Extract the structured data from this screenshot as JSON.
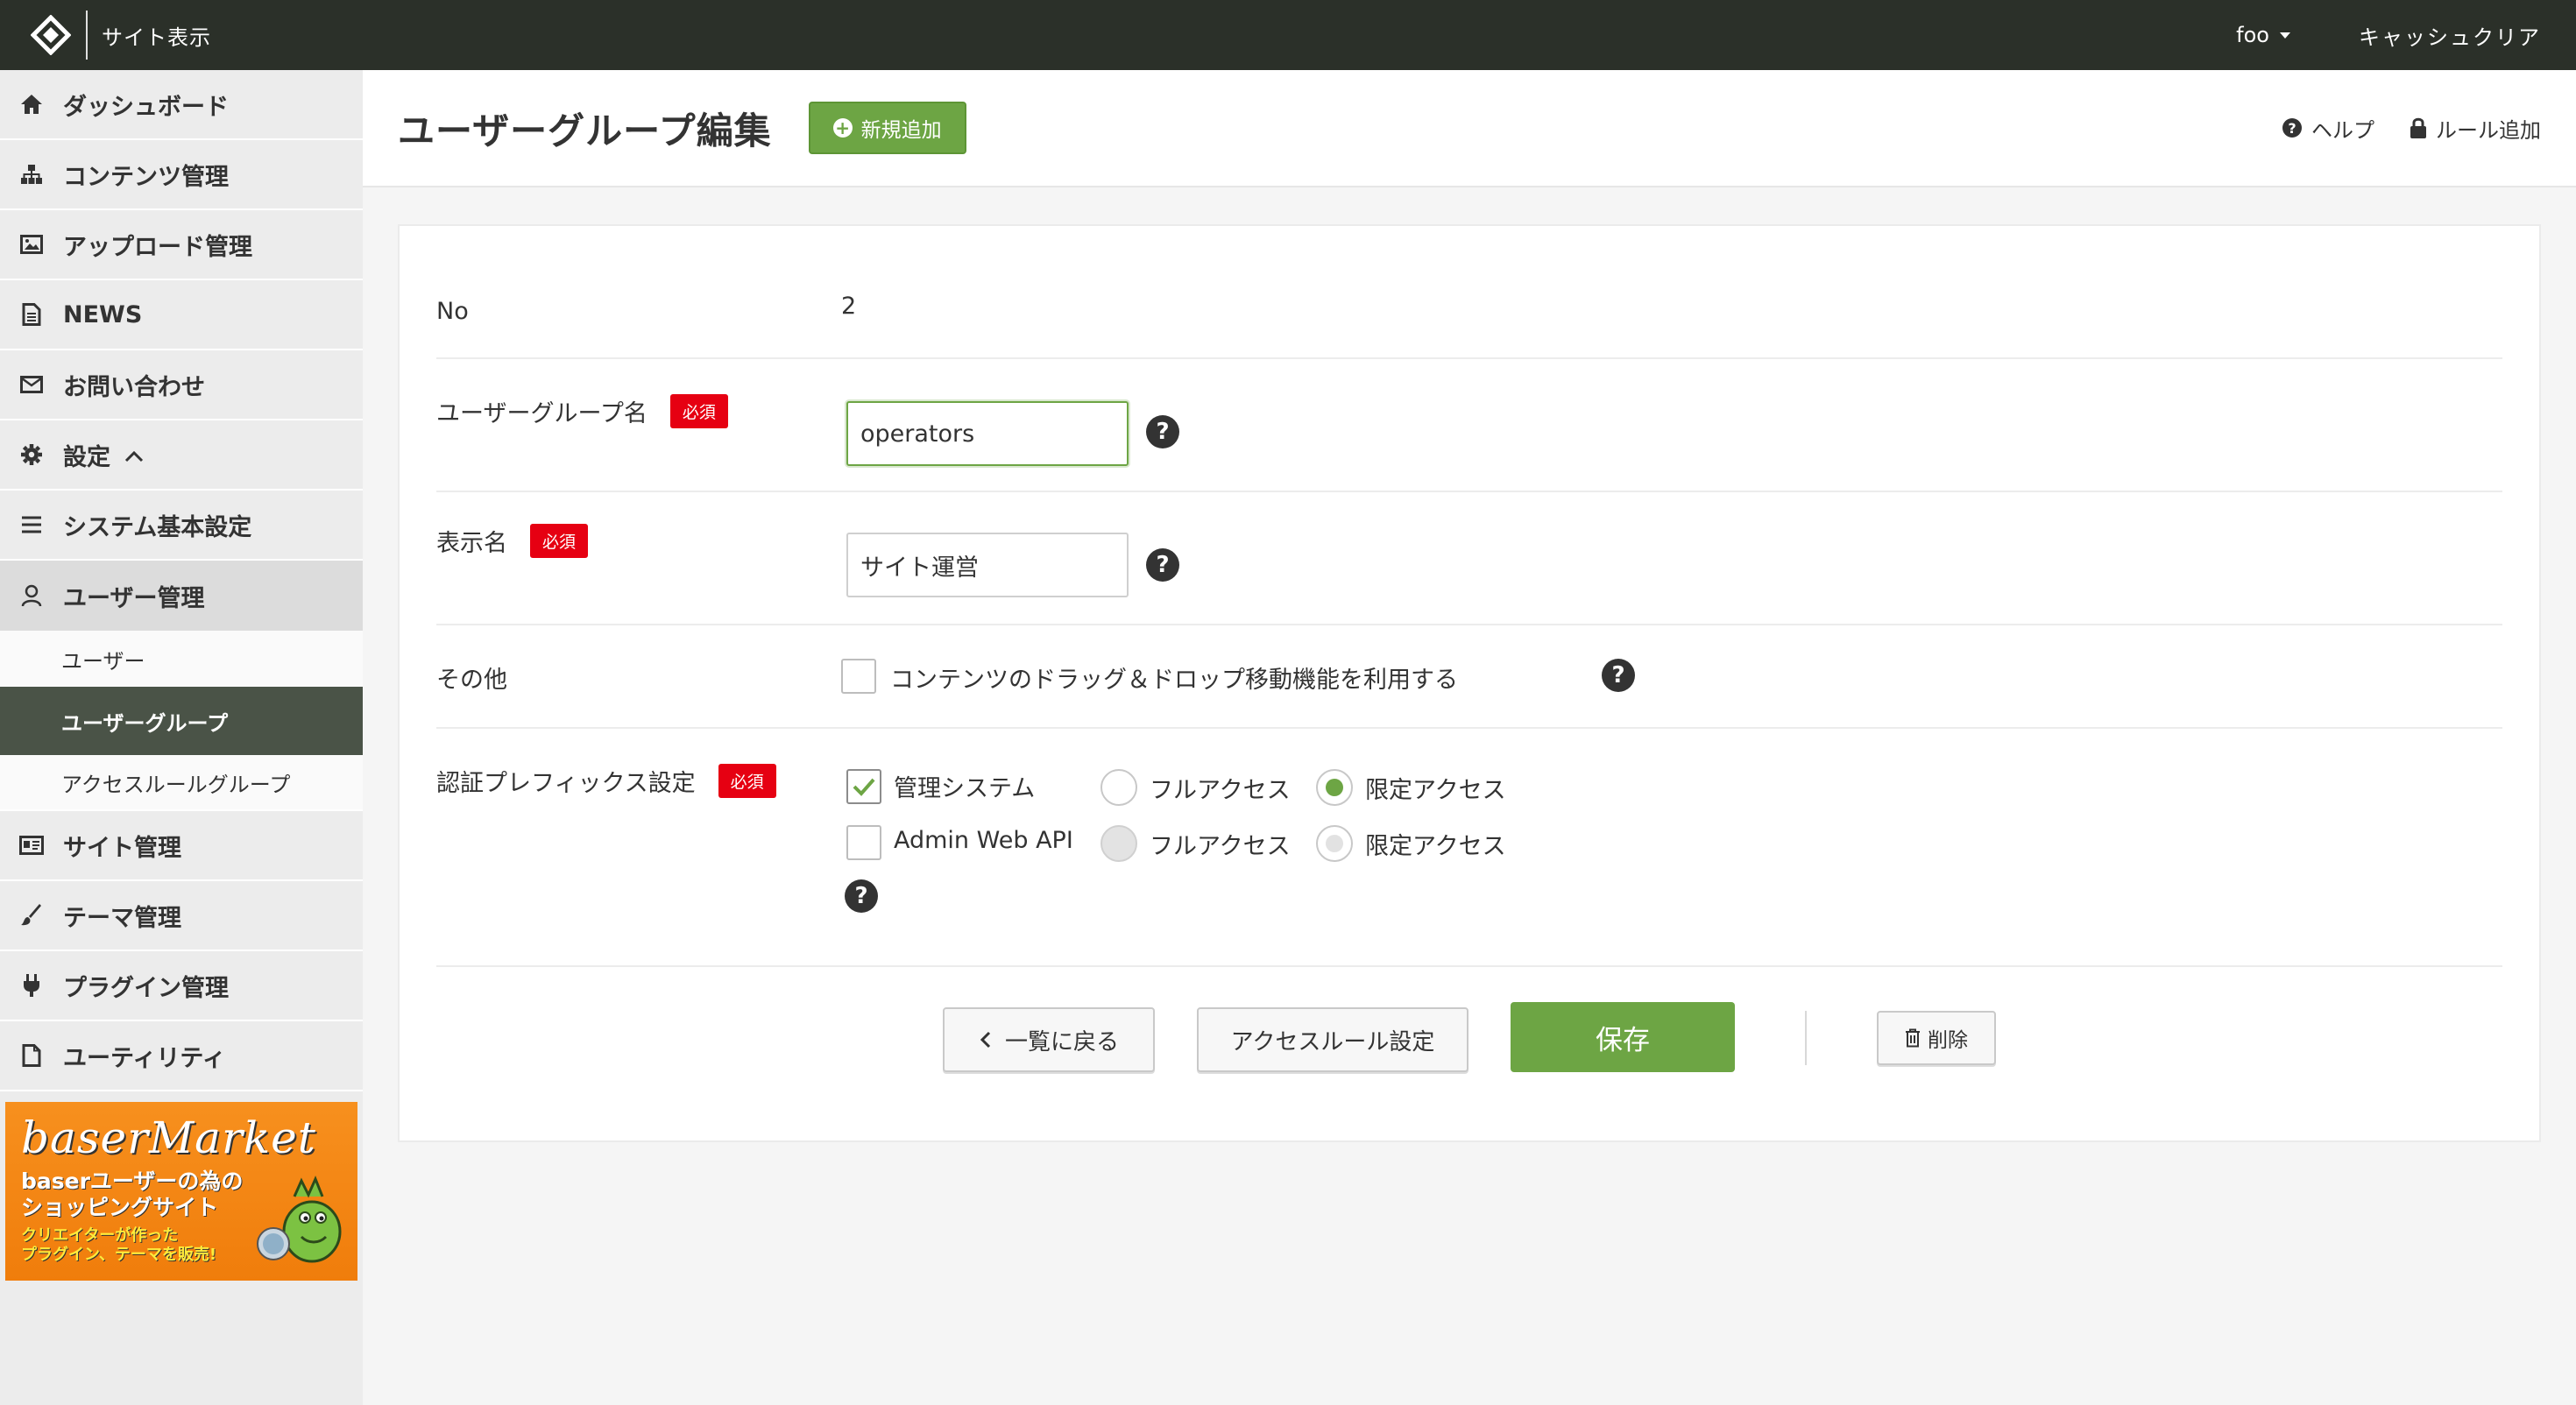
{
  "topbar": {
    "site_view": "サイト表示",
    "user": "foo",
    "cache_clear": "キャッシュクリア"
  },
  "sidebar": {
    "items": [
      {
        "label": "ダッシュボード",
        "icon": "home-icon"
      },
      {
        "label": "コンテンツ管理",
        "icon": "sitemap-icon"
      },
      {
        "label": "アップロード管理",
        "icon": "image-icon"
      },
      {
        "label": "NEWS",
        "icon": "document-icon"
      },
      {
        "label": "お問い合わせ",
        "icon": "mail-icon"
      },
      {
        "label": "設定",
        "icon": "gear-icon"
      },
      {
        "label": "システム基本設定",
        "icon": "list-icon"
      },
      {
        "label": "ユーザー管理",
        "icon": "user-icon"
      },
      {
        "label": "サイト管理",
        "icon": "id-card-icon"
      },
      {
        "label": "テーマ管理",
        "icon": "brush-icon"
      },
      {
        "label": "プラグイン管理",
        "icon": "plug-icon"
      },
      {
        "label": "ユーティリティ",
        "icon": "file-icon"
      }
    ],
    "sub_items": [
      "ユーザー",
      "ユーザーグループ",
      "アクセスルールグループ"
    ],
    "banner": {
      "brand": "baserMarket",
      "tagline1": "baserユーザーの為の",
      "tagline2": "ショッピングサイト",
      "tagline3": "クリエイターが作った",
      "tagline4": "プラグイン、テーマを販売!"
    }
  },
  "header": {
    "title": "ユーザーグループ編集",
    "new_button": "新規追加",
    "help": "ヘルプ",
    "add_rule": "ルール追加"
  },
  "form": {
    "no_label": "No",
    "no_value": "2",
    "group_name_label": "ユーザーグループ名",
    "required": "必須",
    "group_name_value": "operators",
    "display_name_label": "表示名",
    "display_name_value": "サイト運営",
    "other_label": "その他",
    "other_option": "コンテンツのドラッグ＆ドロップ移動機能を利用する",
    "auth_label": "認証プレフィックス設定",
    "auth_rows": [
      {
        "name": "管理システム",
        "checked": true,
        "full": "フルアクセス",
        "limited": "限定アクセス"
      },
      {
        "name": "Admin Web API",
        "checked": false,
        "full": "フルアクセス",
        "limited": "限定アクセス"
      }
    ]
  },
  "actions": {
    "back": "一覧に戻る",
    "access_rule": "アクセスルール設定",
    "save": "保存",
    "delete": "削除"
  },
  "colors": {
    "accent": "#6da544",
    "topbar": "#2b3029",
    "required": "#e60012",
    "active_nav": "#4a5347"
  }
}
